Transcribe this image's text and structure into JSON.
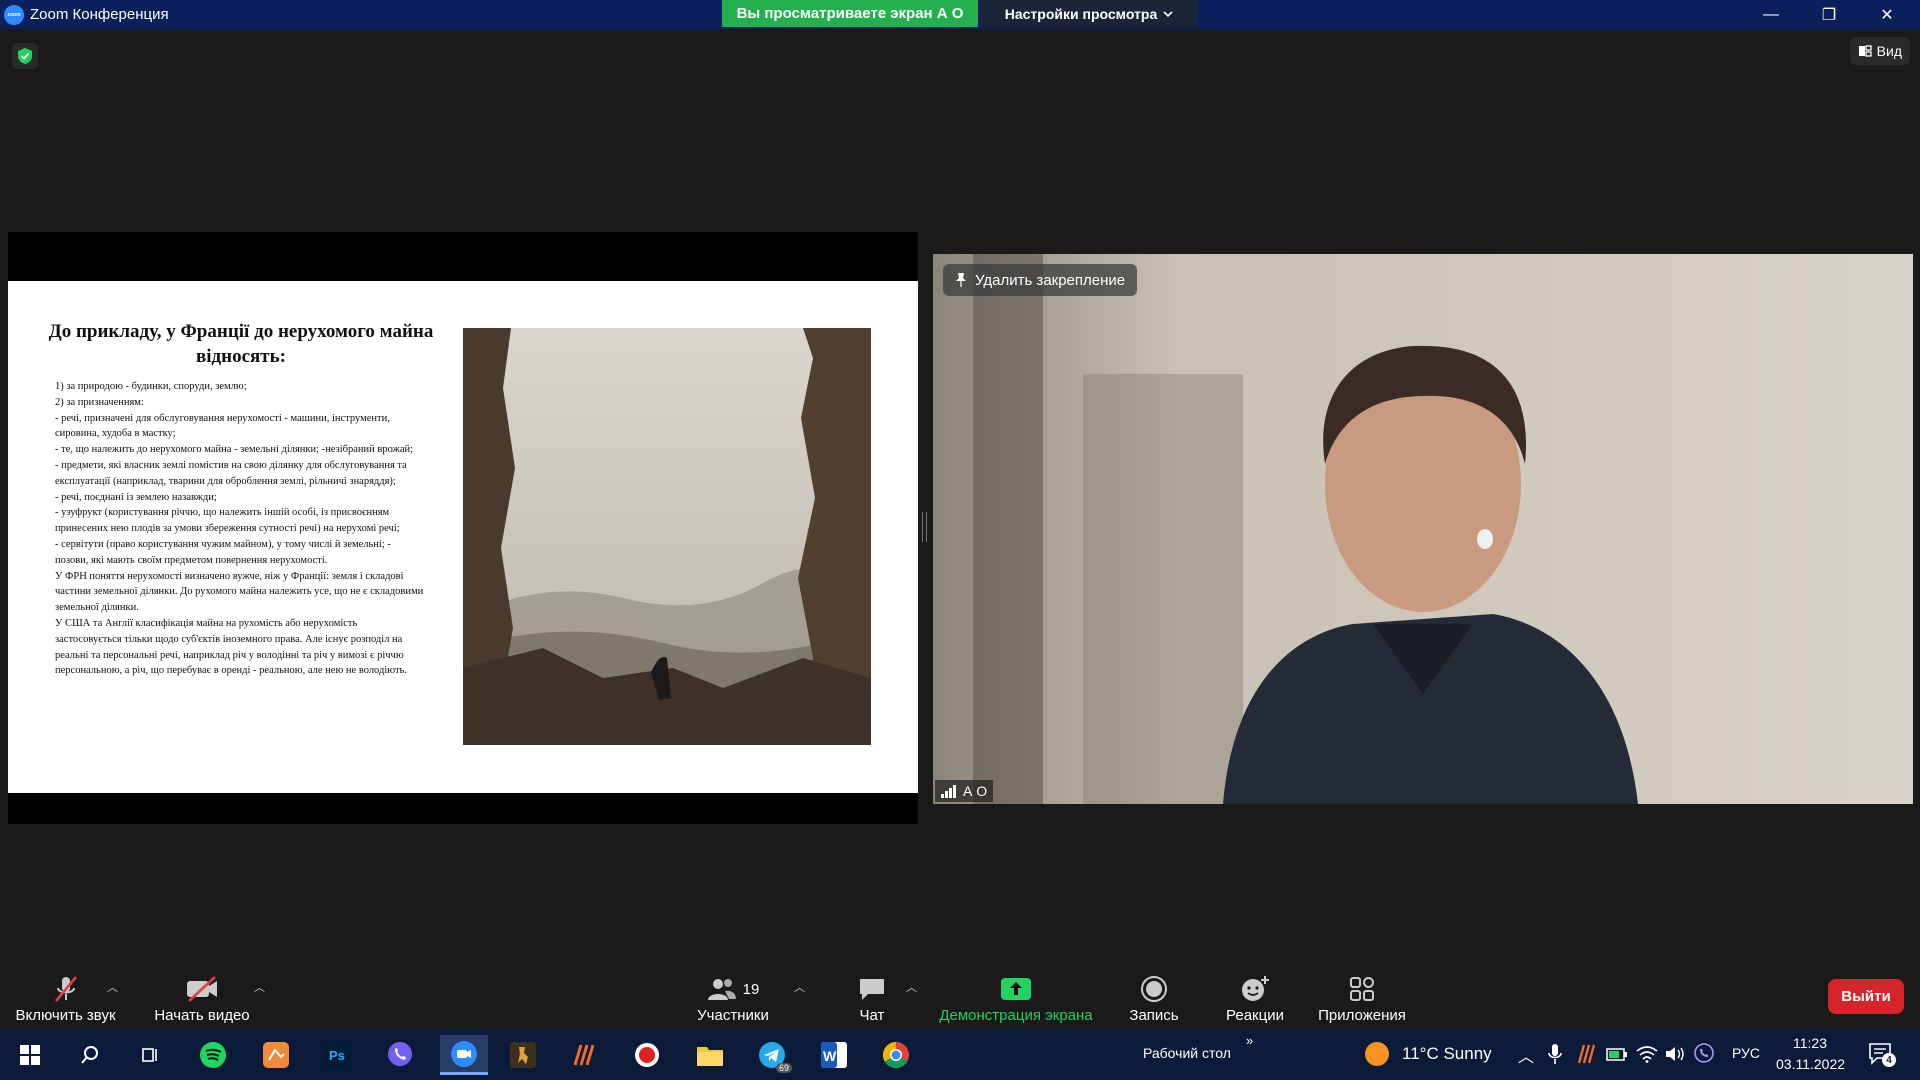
{
  "window": {
    "title": "Zoom Конференция",
    "logo_text": "zoom",
    "share_banner": "Вы просматриваете экран А О",
    "view_options": "Настройки просмотра",
    "minimize": "—",
    "restore": "❐",
    "close": "✕"
  },
  "meeting": {
    "view_label": "Вид"
  },
  "slide": {
    "title": "До прикладу, у Франції до нерухомого майна відносять:",
    "body_lines": [
      "1) за природою - будинки, споруди, землю;",
      "2) за призначенням:",
      "- речі, призначені для обслуговування нерухомості - машини, інструменти, сировина, худоба в мастку;",
      "- те, що належить до нерухомого майна - земельні ділянки; -незібраний врожай;",
      "- предмети, які власник землі помістив на свою ділянку для обслуговування та експлуатації (наприклад, тварини для оброблення землі, рільничі знаряддя);",
      "- речі, поєднані із землею назавжди;",
      "- узуфрукт (користування річчю, що належить іншій особі, із присвоєнням принесених нею плодів за умови збереження сутності речі) на нерухомі речі;",
      "- сервітути (право користування чужим майном), у тому числі й земельні; - позови, які мають своїм предметом повернення нерухомості.",
      "У ФРН поняття нерухомості визначено вужче, ніж у Франції: земля і складові частини земельної ділянки. До рухомого майна належить усе, що не є складовими земельної ділянки.",
      "У США та Англії класифікація майна на рухомість або нерухомість застосовується тільки щодо суб'єктів іноземного права. Але існує розподіл на реальні та персональні речі, наприклад річ у володінні та річ у вимозі є річчю персональною, а річ, що перебуває в оренді - реальною, але нею не володіють."
    ]
  },
  "video": {
    "unpin_label": "Удалить закрепление",
    "participant_name": "А О"
  },
  "toolbar": {
    "unmute": "Включить звук",
    "start_video": "Начать видео",
    "participants": "Участники",
    "participants_count": "19",
    "chat": "Чат",
    "share_screen": "Демонстрация экрана",
    "record": "Запись",
    "reactions": "Реакции",
    "apps": "Приложения",
    "leave": "Выйти"
  },
  "taskbar": {
    "desktop_label": "Рабочий стол",
    "desktop_chevron": "»",
    "weather": "11°C  Sunny",
    "language": "РУС",
    "time": "11:23",
    "date": "03.11.2022",
    "notifications": "4",
    "telegram_badge": "69"
  }
}
